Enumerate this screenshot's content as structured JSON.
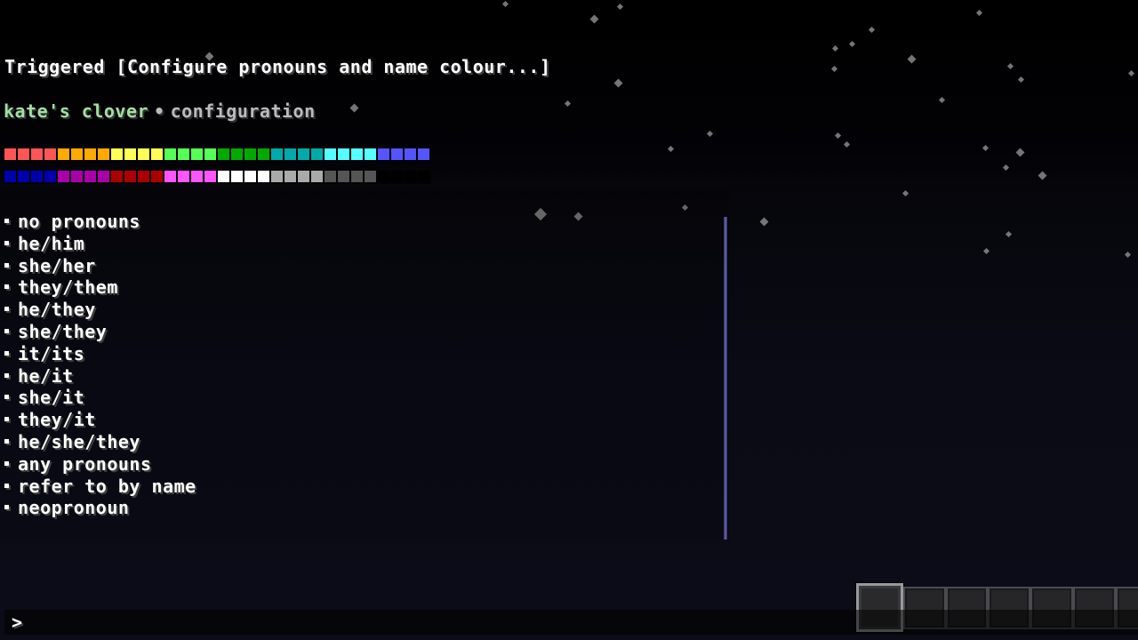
{
  "chat": {
    "triggered_message": "Triggered [Configure pronouns and name colour...]",
    "header": {
      "brand": "kate's clover",
      "separator": "•",
      "section": "configuration"
    },
    "palette": {
      "swatches_per_colour": 4,
      "row_1": [
        {
          "name": "red",
          "color": "#FF5555"
        },
        {
          "name": "gold",
          "color": "#FFAA00"
        },
        {
          "name": "yellow",
          "color": "#FFFF55"
        },
        {
          "name": "green",
          "color": "#55FF55"
        },
        {
          "name": "dark-green",
          "color": "#00AA00"
        },
        {
          "name": "dark-aqua",
          "color": "#00AAAA"
        },
        {
          "name": "aqua",
          "color": "#55FFFF"
        },
        {
          "name": "blue",
          "color": "#5555FF"
        }
      ],
      "row_2": [
        {
          "name": "dark-blue",
          "color": "#0000AA"
        },
        {
          "name": "dark-purple",
          "color": "#AA00AA"
        },
        {
          "name": "dark-red",
          "color": "#AA0000"
        },
        {
          "name": "light-purple",
          "color": "#FF55FF"
        },
        {
          "name": "white",
          "color": "#FFFFFF"
        },
        {
          "name": "gray",
          "color": "#AAAAAA"
        },
        {
          "name": "dark-gray",
          "color": "#555555"
        },
        {
          "name": "black",
          "color": "#000000"
        }
      ]
    },
    "pronouns": [
      "no pronouns",
      "he/him",
      "she/her",
      "they/them",
      "he/they",
      "she/they",
      "it/its",
      "he/it",
      "she/it",
      "they/it",
      "he/she/they",
      "any pronouns",
      "refer to by name",
      "neopronoun"
    ],
    "input": {
      "prompt": ">",
      "value": ""
    }
  },
  "hotbar": {
    "selected_slot": 1,
    "visible_slots": 7
  },
  "colors": {
    "brand_green": "#A6DCA6",
    "section_gray": "#BBBBBB",
    "scrollbar": "#5A5A9C"
  }
}
